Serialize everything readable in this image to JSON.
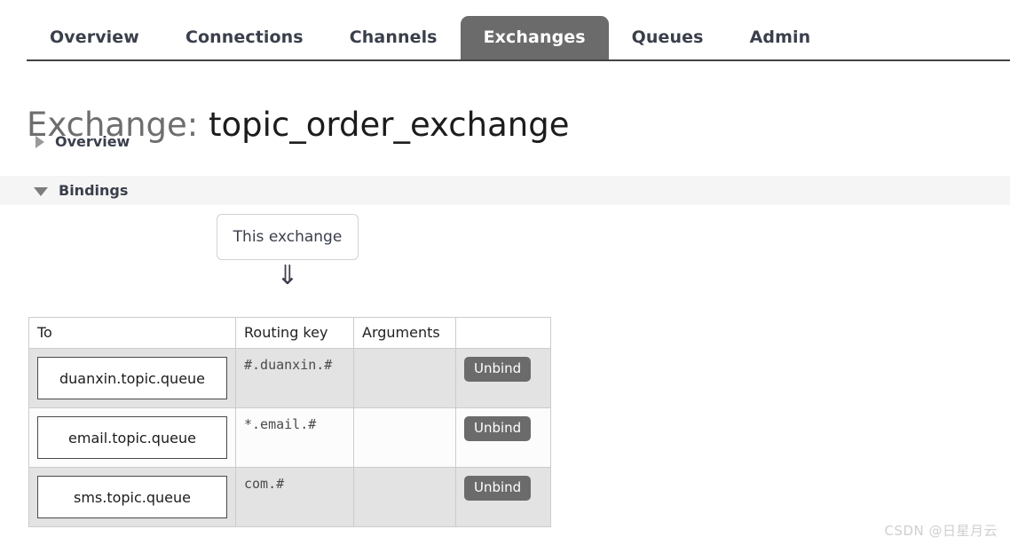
{
  "nav": {
    "items": [
      {
        "label": "Overview",
        "active": false
      },
      {
        "label": "Connections",
        "active": false
      },
      {
        "label": "Channels",
        "active": false
      },
      {
        "label": "Exchanges",
        "active": true
      },
      {
        "label": "Queues",
        "active": false
      },
      {
        "label": "Admin",
        "active": false
      }
    ]
  },
  "page": {
    "title_label": "Exchange:",
    "title_value": "topic_order_exchange"
  },
  "sections": {
    "overview": {
      "label": "Overview",
      "expanded": false,
      "toggle_icon": "triangle-right-icon"
    },
    "bindings": {
      "label": "Bindings",
      "expanded": true,
      "toggle_icon": "triangle-down-icon"
    }
  },
  "diagram": {
    "source_node_label": "This exchange",
    "arrow_glyph": "⇓",
    "arrow_icon": "double-down-arrow-icon"
  },
  "bindings_table": {
    "columns": [
      "To",
      "Routing key",
      "Arguments",
      ""
    ],
    "rows": [
      {
        "to": "duanxin.topic.queue",
        "routing_key": "#.duanxin.#",
        "arguments": "",
        "action_label": "Unbind"
      },
      {
        "to": "email.topic.queue",
        "routing_key": "*.email.#",
        "arguments": "",
        "action_label": "Unbind"
      },
      {
        "to": "sms.topic.queue",
        "routing_key": "com.#",
        "arguments": "",
        "action_label": "Unbind"
      }
    ]
  },
  "watermark": {
    "text": "CSDN @日星月云"
  },
  "colors": {
    "active_tab_bg": "#6b6b6b",
    "button_bg": "#6b6b6b",
    "section_band_bg": "#f5f5f5",
    "row_shaded_bg": "#e3e3e3",
    "row_plain_bg": "#fcfcfc",
    "nav_text": "#3a3f4b",
    "watermark_text": "#cfcfcf"
  }
}
